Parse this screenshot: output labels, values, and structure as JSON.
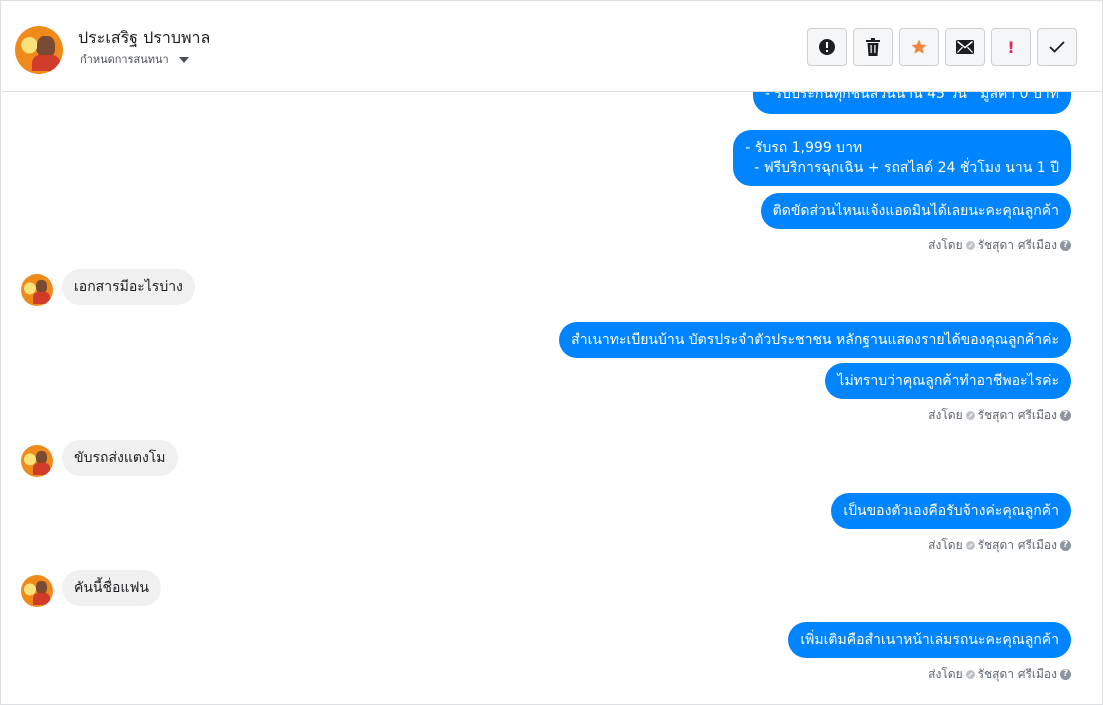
{
  "header": {
    "name": "ประเสริฐ ปราบพาล",
    "subtitle": "กำหนดการสนทนา",
    "toolbar": [
      {
        "icon": "alert-circle-icon",
        "label": ""
      },
      {
        "icon": "trash-icon",
        "label": ""
      },
      {
        "icon": "star-icon",
        "label": "",
        "color": "#f5853f"
      },
      {
        "icon": "envelope-icon",
        "label": ""
      },
      {
        "icon": "exclamation-icon",
        "label": "!",
        "color": "#e0245e"
      },
      {
        "icon": "check-icon",
        "label": ""
      }
    ]
  },
  "messages": {
    "m0": "- รับประกันทุกชิ้นส่วนนาน 45 วัน   มูลค่า 0 บาท",
    "m1": "- รับรถ 1,999 บาท\n  - ฟรีบริการฉุกเฉิน + รถสไลด์ 24 ชั่วโมง นาน 1 ปี",
    "m2": "ติดขัดส่วนไหนแจ้งแอดมินได้เลยนะคะคุณลูกค้า",
    "m3": "เอกสารมีอะไรบ่าง",
    "m4": "สำเนาทะเบียนบ้าน บัตรประจำตัวประชาชน หลักฐานแสดงรายได้ของคุณลูกค้าค่ะ",
    "m5": "ไม่ทราบว่าคุณลูกค้าทำอาชีพอะไรค่ะ",
    "m6": "ขับรถส่งแตงโม",
    "m7": "เป็นของตัวเองคือรับจ้างค่ะคุณลูกค้า",
    "m8": "คันนี้ชื่อแฟน",
    "m9": "เพิ่มเติมคือสำเนาหน้าเล่มรถนะคะคุณลูกค้า"
  },
  "sent_by": {
    "prefix": "ส่งโดย",
    "agent": "รัชสุดา ศรีเมือง"
  }
}
